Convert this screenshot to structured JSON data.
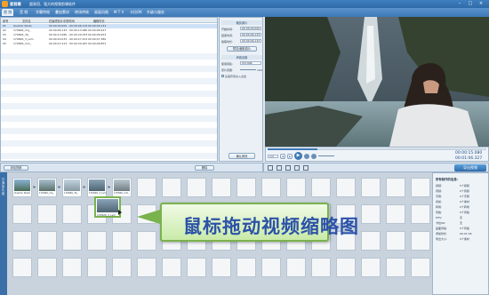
{
  "app": {
    "name": "爱剪辑",
    "subtitle": "超易用、强大的视频剪辑软件"
  },
  "tabs": [
    "视 频",
    "音 频",
    "字幕特效",
    "叠加素材",
    "转场特效",
    "画面风格",
    "M T V",
    "卡拉OK",
    "升级与服务"
  ],
  "file_table": {
    "headers": [
      "序号",
      "文件名",
      "在最终影片中的时间",
      "截取时长"
    ],
    "rows": [
      [
        "01",
        "Quarter Pants",
        "00:00:00.000 - 00:00:06.133",
        "00:00:06.133"
      ],
      [
        "02",
        "170826_mq_",
        "00:00:06.133 - 00:00:13.080",
        "00:00:06.947"
      ],
      [
        "03",
        "170826_3b_",
        "00:00:13.080 - 00:00:20.033",
        "00:00:06.953"
      ],
      [
        "04",
        "170826_3_Lsm",
        "00:00:20.033 - 00:00:27.413",
        "00:00:07.380"
      ],
      [
        "05",
        "170826_mm_",
        "00:00:27.413 - 00:00:34.267",
        "00:00:06.853"
      ]
    ]
  },
  "clip_settings": {
    "section1": "裁剪原片",
    "start_label": "开始时间:",
    "start_value": "00:00:00.000",
    "end_label": "结束时间:",
    "end_value": "00:00:06.133",
    "cut_label": "截取时长:",
    "cut_value": "00:00:06.133",
    "preview_button": "预览/截取原片",
    "section2": "声音设置",
    "track_label": "使用音轨:",
    "track_value": "原片音轨",
    "volume_label": "原片音量:",
    "volume_value": "100",
    "fade_label": "头尾声音淡入淡出",
    "confirm_button": "确认修改"
  },
  "player": {
    "time_current": "00:00:15.080",
    "time_total": "00:01:06.327",
    "speed_value": "1/4"
  },
  "toolbar": {
    "add_video": "添加视频",
    "delete": "删除",
    "export": "导出视频"
  },
  "timeline": {
    "side_label": "已添加片段",
    "clips": [
      "Quarter Pants",
      "170826_mq_",
      "170826_3b_",
      "170826_3_Lsm",
      "170826_mm_"
    ],
    "drag_clip": "170826_3_Lsm"
  },
  "info_panel": {
    "title": "所有制作的信息:",
    "items": [
      [
        "视频:",
        "5个视频"
      ],
      [
        "音频:",
        "0个音频"
      ],
      [
        "字幕:",
        "0个字幕"
      ],
      [
        "叠加:",
        "0个素材"
      ],
      [
        "转场:",
        "0个转场"
      ],
      [
        "风格:",
        "0个风格"
      ],
      [
        "MTV:",
        "无"
      ],
      [
        "卡拉OK:",
        "无"
      ],
      [
        "画面风格:",
        "0个风格"
      ],
      [
        "添加时长:",
        "00:01:06"
      ],
      [
        "导出大小:",
        "0个素材"
      ]
    ]
  },
  "banner": "鼠标拖动视频缩略图"
}
